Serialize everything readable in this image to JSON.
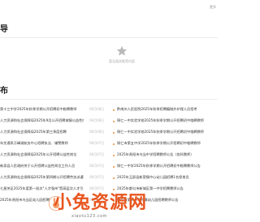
{
  "topbar": {
    "link_label": "更多"
  },
  "section1": {
    "title": "导"
  },
  "empty_state": {
    "icon": "star-icon",
    "text": "暂无相关推荐内容"
  },
  "section2": {
    "title": "布"
  },
  "news_left": [
    {
      "title": "第十三中学2025年秋季学期公开招聘初中临聘教师",
      "date": "08月08日"
    },
    {
      "title": "人力资源和社会保障局2025年9月公开招聘城镇公益性岗位",
      "date": "08月08日"
    },
    {
      "title": "人力资源和社会保障局2025年第三季度招聘",
      "date": "08月08日"
    },
    {
      "title": "年交通系万峰湖航务中心招聘执法、辅警教师",
      "date": "08月07日"
    },
    {
      "title": "人力资源和社会保障局2025年公开招聘公益性岗位",
      "date": "08月07日"
    },
    {
      "title": "新泉县人民政府关于公开招聘公益性岗位工作人员",
      "date": "08月07日"
    },
    {
      "title": "人力资源和社会保障局2025年第四期公开招聘劳务派遣人员",
      "date": "08月07日"
    },
    {
      "title": "七星关区2025年度第一批次\"人才强市\"暨高层次人才引进",
      "date": "08月07日"
    },
    {
      "title": "2025年贵阳市乌当区幼儿园招聘教师",
      "date": "08月07日"
    }
  ],
  "news_right": [
    {
      "title": "黔南州人民医院2025年秋季招聘编制外护理人员招考"
    },
    {
      "title": "铜仁一中实验学校2025年秋季学期公开招聘初中临聘教师"
    },
    {
      "title": "铜仁一中实验学校2025年秋季学期公开招聘初中临聘教师"
    },
    {
      "title": "铜仁市第五中学2025年秋季学期公开招聘初中临聘教师"
    },
    {
      "title": "2025年贵阳市乌当中学招聘教师公告（各科教师）"
    },
    {
      "title": "铜仁一中学2025年秋季学期公开招聘初中临聘教师公告"
    },
    {
      "title": "2025年玉屏县新营镇中心幼儿园招聘1名保育员"
    },
    {
      "title": "2025年都匀市新城区第一中学招聘教师公告"
    },
    {
      "title": "铜仁市第十小学附属幼儿园招聘教师公告"
    }
  ],
  "watermark": {
    "main": "小兔资源网",
    "sub": "xiaotu123.com",
    "badge_icon": "rabbit-icon"
  }
}
